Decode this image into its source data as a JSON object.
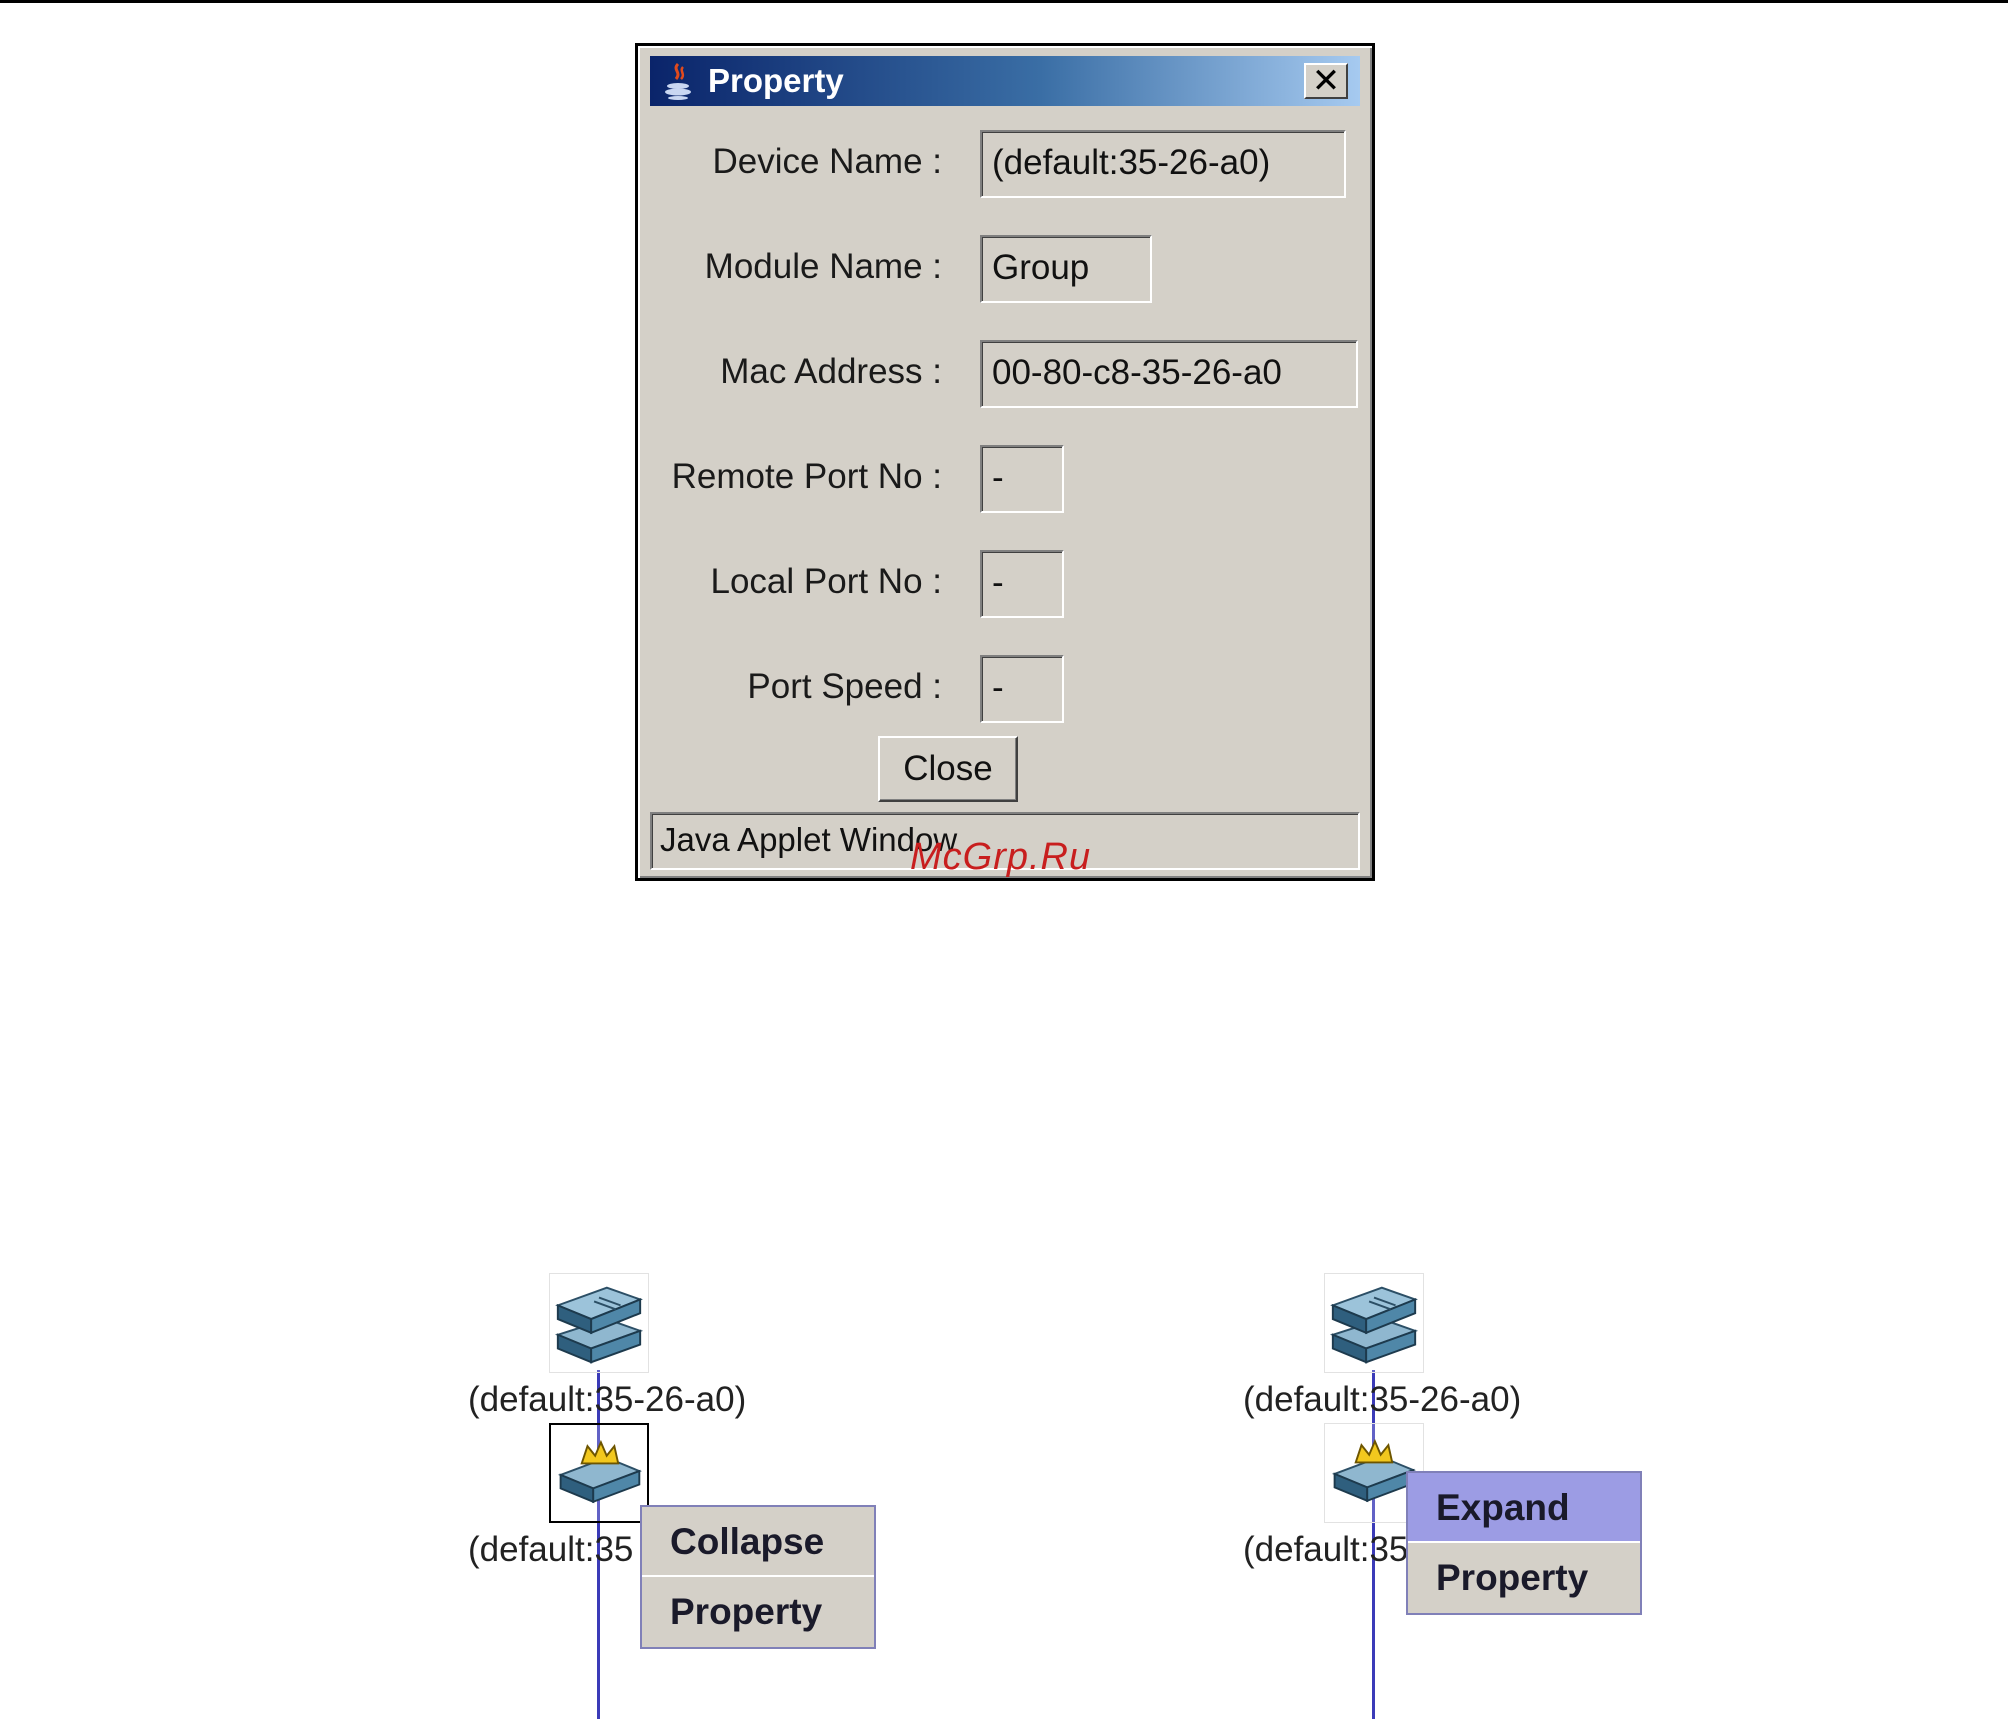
{
  "dialog": {
    "title": "Property",
    "close_glyph": "✕",
    "fields": [
      {
        "label": "Device Name :",
        "value": "(default:35-26-a0)"
      },
      {
        "label": "Module Name :",
        "value": "Group"
      },
      {
        "label": "Mac Address :",
        "value": "00-80-c8-35-26-a0"
      },
      {
        "label": "Remote Port No :",
        "value": "-"
      },
      {
        "label": "Local Port No :",
        "value": "-"
      },
      {
        "label": "Port Speed :",
        "value": "-"
      }
    ],
    "close_button": "Close",
    "status": "Java Applet Window"
  },
  "watermark": "McGrp.Ru",
  "left_panel": {
    "top_node_label": "(default:35-26-a0)",
    "bottom_node_label": "(default:35",
    "menu": [
      "Collapse",
      "Property"
    ]
  },
  "right_panel": {
    "top_node_label": "(default:35-26-a0)",
    "bottom_node_label": "(default:35",
    "menu": [
      "Expand",
      "Property"
    ]
  },
  "colors": {
    "title_gradient_start": "#0a246a",
    "menu_highlight": "#9c9ce4",
    "link_line": "#3b3bb8",
    "watermark": "#c81e1e"
  }
}
